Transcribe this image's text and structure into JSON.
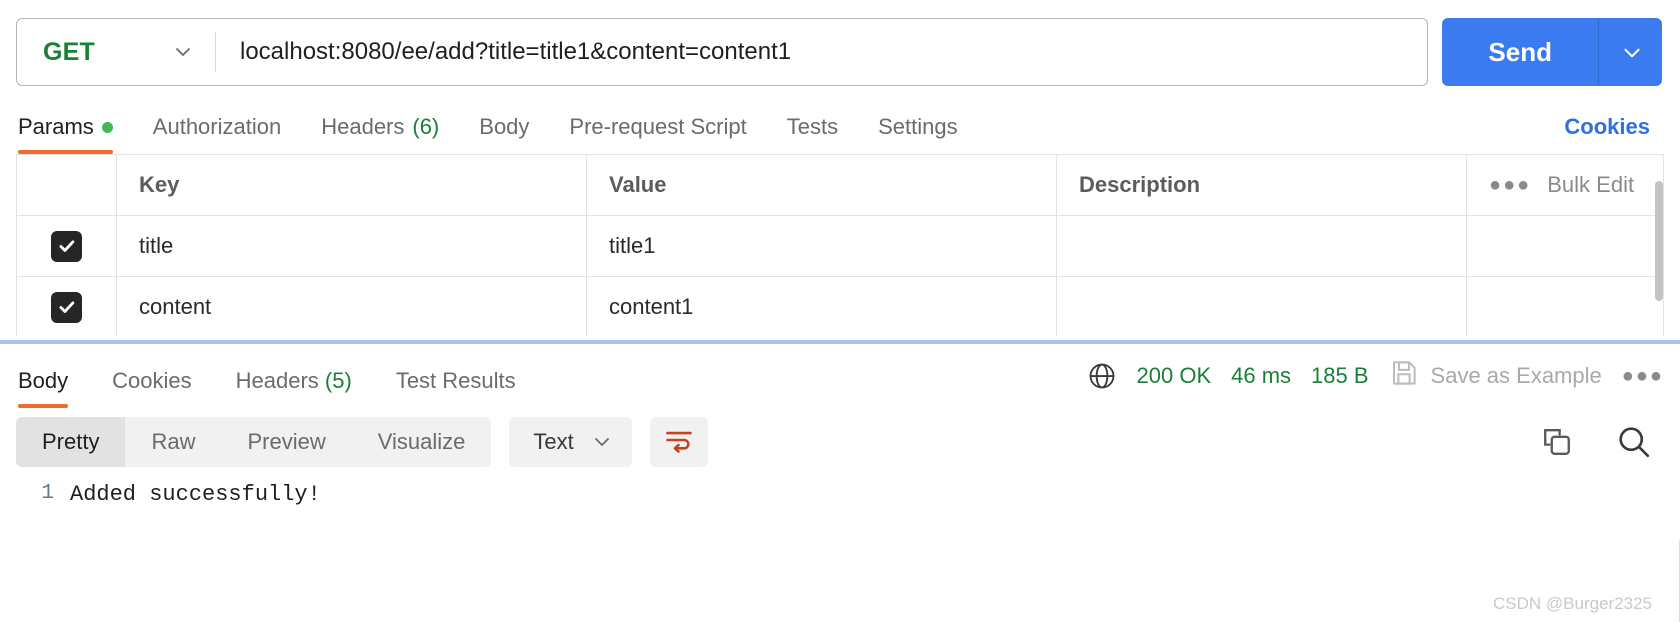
{
  "request": {
    "method": "GET",
    "url": "localhost:8080/ee/add?title=title1&content=content1",
    "send_label": "Send",
    "tabs": [
      {
        "label": "Params",
        "count": "",
        "active": true,
        "dot": true
      },
      {
        "label": "Authorization",
        "count": "",
        "active": false,
        "dot": false
      },
      {
        "label": "Headers",
        "count": "(6)",
        "active": false,
        "dot": false
      },
      {
        "label": "Body",
        "count": "",
        "active": false,
        "dot": false
      },
      {
        "label": "Pre-request Script",
        "count": "",
        "active": false,
        "dot": false
      },
      {
        "label": "Tests",
        "count": "",
        "active": false,
        "dot": false
      },
      {
        "label": "Settings",
        "count": "",
        "active": false,
        "dot": false
      }
    ],
    "cookies_link": "Cookies"
  },
  "params_table": {
    "headers": {
      "key": "Key",
      "value": "Value",
      "description": "Description"
    },
    "bulk_edit": "Bulk Edit",
    "rows": [
      {
        "enabled": true,
        "key": "title",
        "value": "title1",
        "description": ""
      },
      {
        "enabled": true,
        "key": "content",
        "value": "content1",
        "description": ""
      }
    ]
  },
  "response": {
    "tabs": [
      {
        "label": "Body",
        "count": "",
        "active": true
      },
      {
        "label": "Cookies",
        "count": "",
        "active": false
      },
      {
        "label": "Headers",
        "count": "(5)",
        "active": false
      },
      {
        "label": "Test Results",
        "count": "",
        "active": false
      }
    ],
    "status": "200 OK",
    "time": "46 ms",
    "size": "185 B",
    "save_as_example": "Save as Example",
    "view_modes": [
      {
        "label": "Pretty",
        "active": true
      },
      {
        "label": "Raw",
        "active": false
      },
      {
        "label": "Preview",
        "active": false
      },
      {
        "label": "Visualize",
        "active": false
      }
    ],
    "format": "Text",
    "body_lines": [
      {
        "number": "1",
        "text": "Added successfully!"
      }
    ]
  },
  "watermark": "CSDN @Burger2325",
  "colors": {
    "method_green": "#1a7f37",
    "send_blue": "#3a7bef",
    "accent_orange": "#ef6c2f",
    "link_blue": "#2f6fe0",
    "status_green": "#1a7f37"
  }
}
